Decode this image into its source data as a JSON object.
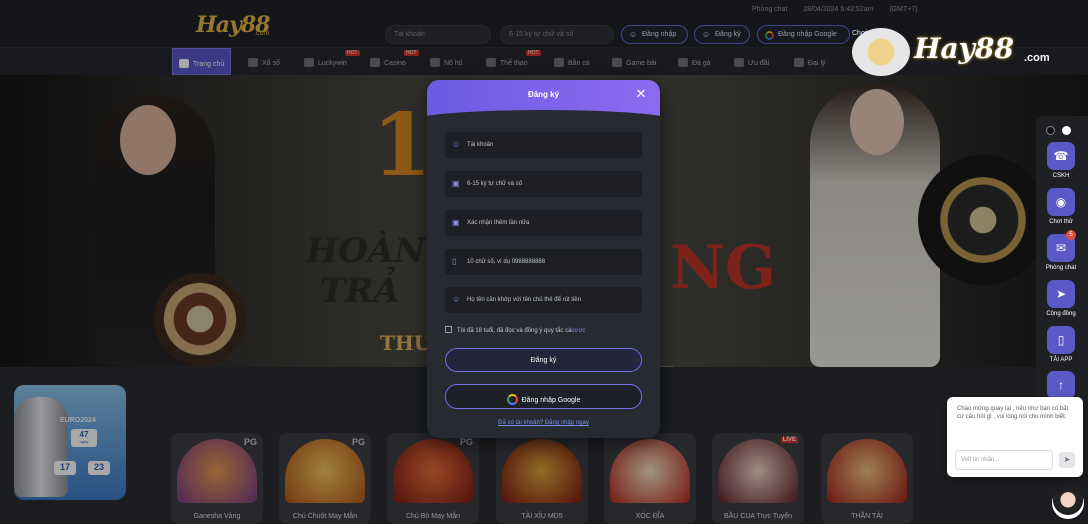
{
  "header": {
    "logo_text": "Hay88",
    "logo_sub": ".com",
    "phong_chat": "Phòng chat",
    "datetime": "28/04/2024 5:42:52am",
    "timezone": "(GMT+7)",
    "username_placeholder": "Tài khoản",
    "password_placeholder": "6-15 ký tự chữ và số",
    "login_label": "Đăng nhập",
    "register_label": "Đăng ký",
    "google_label": "Đăng nhập Google",
    "trial_label": "Chơi thử"
  },
  "nav": {
    "items": [
      {
        "label": "Trang chủ"
      },
      {
        "label": "Xổ số"
      },
      {
        "label": "Luckywin"
      },
      {
        "label": "Casino"
      },
      {
        "label": "Nổ hũ"
      },
      {
        "label": "Thể thao"
      },
      {
        "label": "Bắn cá"
      },
      {
        "label": "Game bài"
      },
      {
        "label": "Đá gà"
      },
      {
        "label": "Ưu đãi"
      },
      {
        "label": "Đại lý"
      }
    ],
    "hot_label": "HOT"
  },
  "banner": {
    "big": "1",
    "line1": "HOÀN",
    "line2": "TRẢ",
    "line3": "NG",
    "line4": "THƯỞ"
  },
  "euro": {
    "title": "EURO2024",
    "days": "47",
    "days_label": "ngày",
    "hours": "17",
    "minutes": "23"
  },
  "games": [
    {
      "name": "Ganesha Vàng",
      "pg": "PG"
    },
    {
      "name": "Chú Chuột May Mắn",
      "pg": "PG"
    },
    {
      "name": "Chú Bò May Mắn",
      "pg": "PG"
    },
    {
      "name": "TÀI XỈU MD5",
      "pg": ""
    },
    {
      "name": "XÓC ĐĨA",
      "pg": ""
    },
    {
      "name": "BẦU CUA Trực Tuyến",
      "pg": "LIVE"
    },
    {
      "name": "THẦN TÀI",
      "pg": ""
    }
  ],
  "modal": {
    "title": "Đăng ký",
    "fields": {
      "account": "Tài khoản",
      "password": "6-15 ký tự chữ và số",
      "confirm": "Xác nhận thêm lần nữa",
      "phone": "10 chữ số, ví dụ 0988888888",
      "fullname": "Họ tên cần khớp với tên chủ thẻ để rút tiền"
    },
    "agree_text": "Tôi đã 18 tuổi, đã đọc và đồng ý quy tắc cá",
    "agree_link": "cược",
    "submit_label": "Đăng ký",
    "google_label": "Đăng nhập Google",
    "login_link": "Đã có tài khoản? Đăng nhập ngay"
  },
  "right_logo": "Hay88",
  "right_logo_sub": ".com",
  "sidebar": {
    "items": [
      {
        "label": "CSKH"
      },
      {
        "label": "Chơi thử"
      },
      {
        "label": "Phòng chat",
        "badge": "5"
      },
      {
        "label": "Cộng đồng"
      },
      {
        "label": "TẢI APP"
      }
    ]
  },
  "chat": {
    "message": "Chào mừng quay lại , nếu như bạn có bất cứ câu hỏi gì , vui lòng nói cho mình biết.",
    "placeholder": "Viết tin nhắn..."
  },
  "colors": {
    "accent": "#6c5be3",
    "link": "#7c8ff0",
    "gold": "#e6b648"
  }
}
